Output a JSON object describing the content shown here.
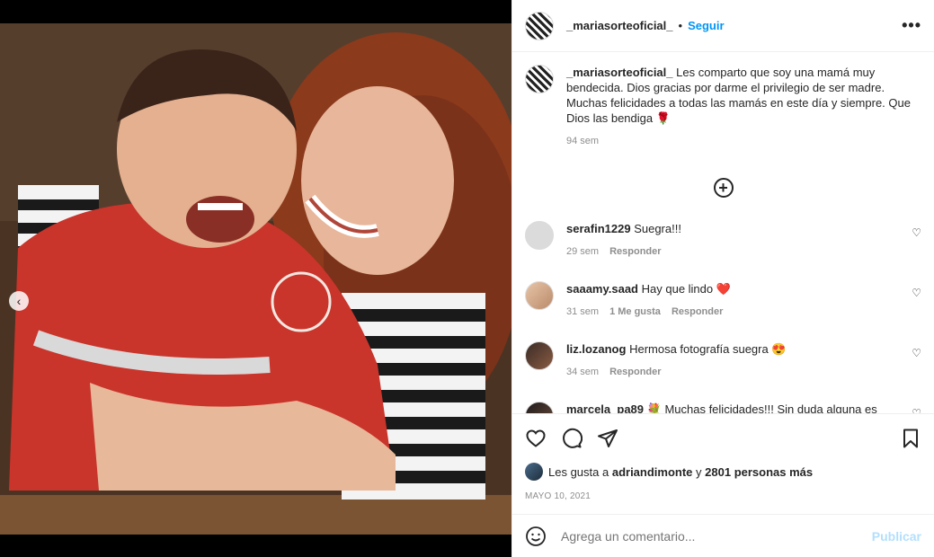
{
  "post": {
    "username": "_mariasorteoficial_",
    "separator": "•",
    "follow_label": "Seguir",
    "more_label": "•••"
  },
  "caption": {
    "username": "_mariasorteoficial_",
    "text": "Les comparto que soy una mamá muy bendecida. Dios gracias por darme el privilegio de ser madre. Muchas felicidades a todas las mamás en este día y siempre. Que Dios las bendiga 🌹",
    "time": "94 sem"
  },
  "load_more_icon": "+",
  "comments": [
    {
      "username": "serafin1229",
      "text": "Suegra!!!",
      "time": "29 sem",
      "likes": "",
      "reply": "Responder",
      "avatar_icon": "default-avatar-icon"
    },
    {
      "username": "saaamy.saad",
      "text": "Hay que lindo ❤️",
      "time": "31 sem",
      "likes": "1 Me gusta",
      "reply": "Responder",
      "avatar_icon": "user-avatar"
    },
    {
      "username": "liz.lozanog",
      "text": "Hermosa fotografía suegra 😍",
      "time": "34 sem",
      "likes": "",
      "reply": "Responder",
      "avatar_icon": "user-avatar"
    },
    {
      "username": "marcela_pa89",
      "text": "💐 Muchas felicidades!!! Sin duda alguna es muy bendecida, tiene un hijo maravilloso, Omar!!! 😘👮🖤💙",
      "time": "",
      "likes": "",
      "reply": "",
      "avatar_icon": "user-avatar"
    }
  ],
  "likes": {
    "prefix": "Les gusta a",
    "user": "adriandimonte",
    "connector": "y",
    "others": "2801 personas más"
  },
  "date": "MAYO 10, 2021",
  "add_comment": {
    "placeholder": "Agrega un comentario...",
    "publish_label": "Publicar"
  },
  "carousel": {
    "current": 2,
    "total": 2
  },
  "colors": {
    "accent": "#0095f6",
    "publish_disabled": "#b2dffc",
    "text": "#262626",
    "muted": "#8e8e8e"
  }
}
